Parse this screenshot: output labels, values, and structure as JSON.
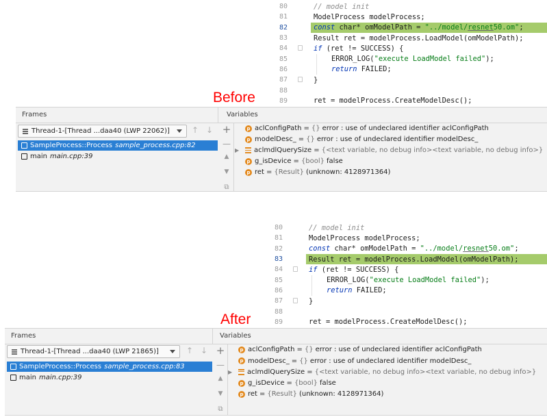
{
  "labels": {
    "before": "Before",
    "after": "After"
  },
  "editor": {
    "lines": [
      {
        "num": "80",
        "indent": 0,
        "fold": false,
        "tokens": [
          {
            "t": "// model init",
            "c": "comment"
          }
        ]
      },
      {
        "num": "81",
        "indent": 0,
        "fold": false,
        "tokens": [
          {
            "t": "ModelProcess modelProcess;",
            "c": ""
          }
        ]
      },
      {
        "num": "82",
        "indent": 0,
        "fold": false,
        "tokens": [
          {
            "t": "const",
            "c": "kw"
          },
          {
            "t": " char* omModelPath = ",
            "c": ""
          },
          {
            "t": "\"../model/",
            "c": "str"
          },
          {
            "t": "resnet",
            "c": "str ul"
          },
          {
            "t": "50.om\"",
            "c": "str"
          },
          {
            "t": ";",
            "c": ""
          }
        ]
      },
      {
        "num": "83",
        "indent": 0,
        "fold": false,
        "tokens": [
          {
            "t": "Result ret = modelProcess.LoadModel(omModelPath);",
            "c": ""
          }
        ]
      },
      {
        "num": "84",
        "indent": 0,
        "fold": true,
        "tokens": [
          {
            "t": "if",
            "c": "kw"
          },
          {
            "t": " (ret != SUCCESS) {",
            "c": ""
          }
        ]
      },
      {
        "num": "85",
        "indent": 1,
        "fold": false,
        "tokens": [
          {
            "t": "ERROR_LOG(",
            "c": "macro"
          },
          {
            "t": "\"execute LoadModel failed\"",
            "c": "str"
          },
          {
            "t": ");",
            "c": ""
          }
        ]
      },
      {
        "num": "86",
        "indent": 1,
        "fold": false,
        "tokens": [
          {
            "t": "return",
            "c": "kw"
          },
          {
            "t": " FAILED;",
            "c": ""
          }
        ]
      },
      {
        "num": "87",
        "indent": 0,
        "fold": true,
        "tokens": [
          {
            "t": "}",
            "c": ""
          }
        ]
      },
      {
        "num": "88",
        "indent": 0,
        "fold": false,
        "tokens": []
      },
      {
        "num": "89",
        "indent": 0,
        "fold": false,
        "tokens": [
          {
            "t": "ret = modelProcess.CreateModelDesc();",
            "c": ""
          }
        ]
      }
    ]
  },
  "panels": [
    {
      "id": "before",
      "highlight_line": "82",
      "frames_title": "Frames",
      "variables_title": "Variables",
      "thread": "Thread-1-[Thread ...daa40 (LWP 22062)]",
      "frames": [
        {
          "func": "SampleProcess::Process",
          "file": "sample_process.cpp:82",
          "selected": true
        },
        {
          "func": "main",
          "file": "main.cpp:39",
          "selected": false
        }
      ]
    },
    {
      "id": "after",
      "highlight_line": "83",
      "frames_title": "Frames",
      "variables_title": "Variables",
      "thread": "Thread-1-[Thread ...daa40 (LWP 21865)]",
      "frames": [
        {
          "func": "SampleProcess::Process",
          "file": "sample_process.cpp:83",
          "selected": true
        },
        {
          "func": "main",
          "file": "main.cpp:39",
          "selected": false
        }
      ]
    }
  ],
  "variables": [
    {
      "icon": "p",
      "name": "aclConfigPath",
      "type": "{}",
      "value": "error : use of undeclared identifier aclConfigPath",
      "expandable": false
    },
    {
      "icon": "p",
      "name": "modelDesc_",
      "type": "{}",
      "value": "error : use of undeclared identifier modelDesc_",
      "expandable": false
    },
    {
      "icon": "array",
      "name": "aclmdlQuerySize",
      "type": "{<text variable, no debug info><text variable, no debug info>}",
      "value": "",
      "expandable": true
    },
    {
      "icon": "p",
      "name": "g_isDevice",
      "type": "{bool}",
      "value": "false",
      "expandable": false
    },
    {
      "icon": "p",
      "name": "ret",
      "type": "{Result}",
      "value": "(unknown: 4128971364)",
      "expandable": false
    }
  ],
  "colors": {
    "highlight": "#a5cb6b",
    "selection": "#2a7fd4",
    "badge": "#e38a1f",
    "label": "#ff0000"
  }
}
